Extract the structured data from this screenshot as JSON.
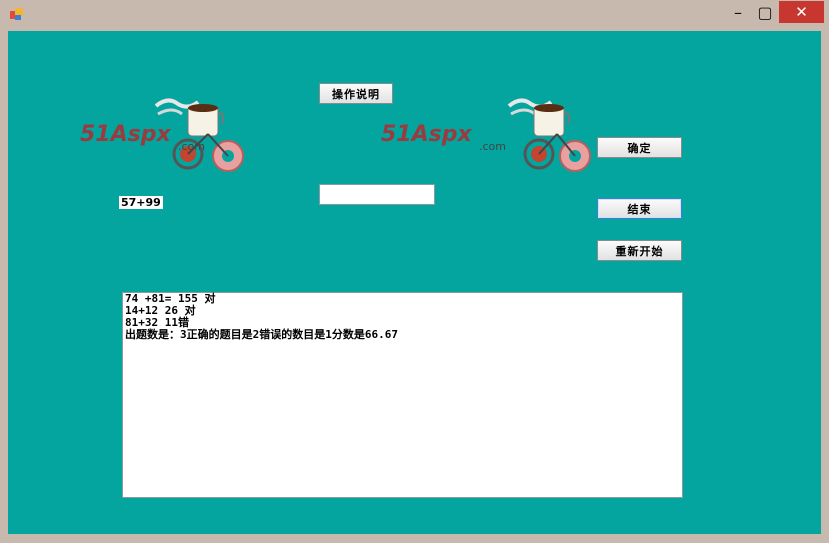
{
  "window": {
    "minimize_glyph": "–",
    "maximize_glyph": "▢",
    "close_glyph": "✕"
  },
  "buttons": {
    "instructions": "操作说明",
    "confirm": "确定",
    "end": "结束",
    "restart": "重新开始"
  },
  "question": "57+99",
  "answer": {
    "value": "",
    "placeholder": ""
  },
  "logo": {
    "text": "51Aspx",
    "suffix": ".com"
  },
  "log_lines": [
    "74 +81= 155 对",
    "14+12 26 对",
    "81+32 11错",
    "出题数是：3正确的题目是2错误的数目是1分数是66.67"
  ],
  "colors": {
    "background": "#04a49f",
    "titlebar": "#c8b9ae",
    "close": "#c7362f"
  }
}
